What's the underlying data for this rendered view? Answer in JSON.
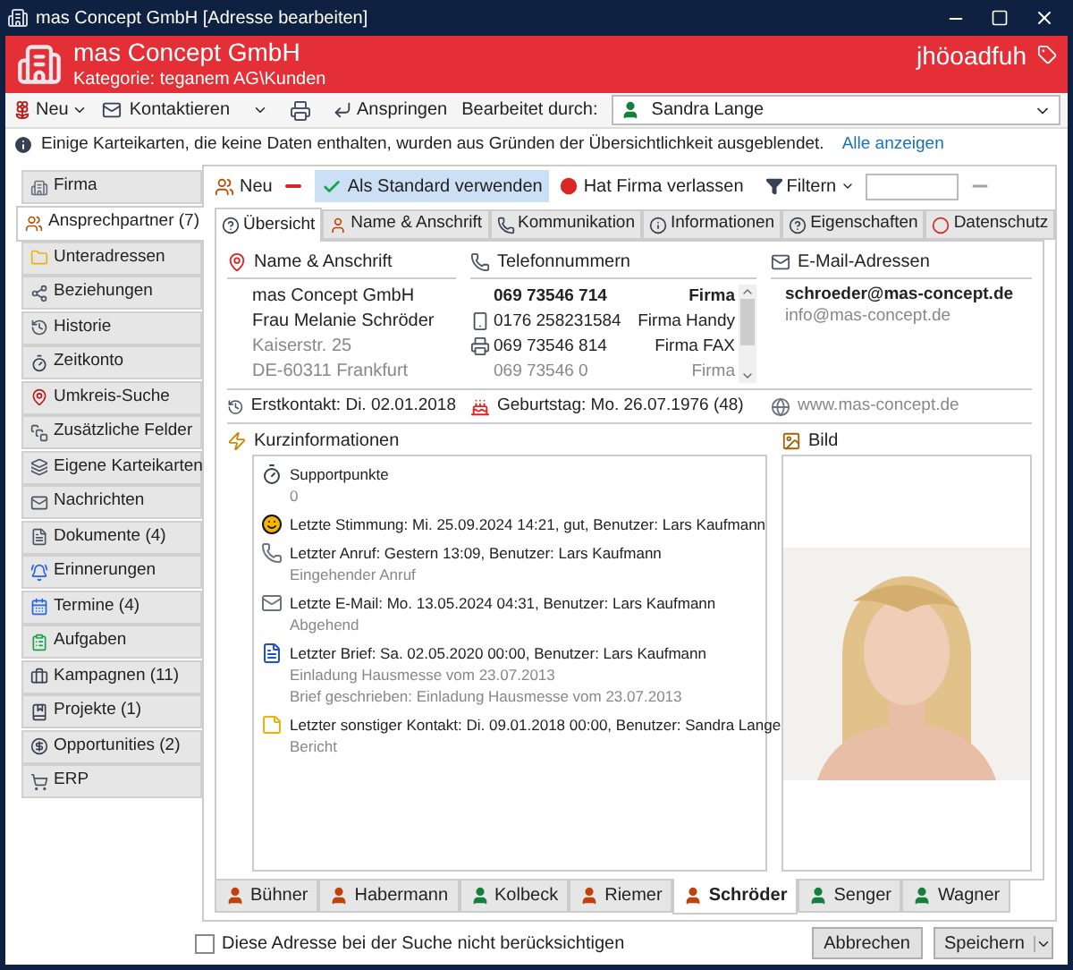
{
  "window": {
    "title": "mas Concept GmbH [Adresse bearbeiten]"
  },
  "header": {
    "company": "mas Concept GmbH",
    "category": "Kategorie: teganem AG\\Kunden",
    "code": "jhöoadfuh"
  },
  "toolbar": {
    "new": "Neu",
    "contact": "Kontaktieren",
    "jump": "Anspringen",
    "edited_by_label": "Bearbeitet durch:",
    "edited_by": "Sandra Lange"
  },
  "info_bar": {
    "message": "Einige Karteikarten, die keine Daten enthalten, wurden aus Gründen der Übersichtlichkeit ausgeblendet.",
    "link": "Alle anzeigen"
  },
  "sidebar": {
    "items": [
      {
        "label": "Firma",
        "selected": false
      },
      {
        "label": "Ansprechpartner (7)",
        "selected": true
      },
      {
        "label": "Unteradressen",
        "selected": false
      },
      {
        "label": "Beziehungen",
        "selected": false
      },
      {
        "label": "Historie",
        "selected": false
      },
      {
        "label": "Zeitkonto",
        "selected": false
      },
      {
        "label": "Umkreis-Suche",
        "selected": false
      },
      {
        "label": "Zusätzliche Felder",
        "selected": false
      },
      {
        "label": "Eigene Karteikarten",
        "selected": false
      },
      {
        "label": "Nachrichten",
        "selected": false
      },
      {
        "label": "Dokumente (4)",
        "selected": false
      },
      {
        "label": "Erinnerungen",
        "selected": false
      },
      {
        "label": "Termine (4)",
        "selected": false
      },
      {
        "label": "Aufgaben",
        "selected": false
      },
      {
        "label": "Kampagnen (11)",
        "selected": false
      },
      {
        "label": "Projekte (1)",
        "selected": false
      },
      {
        "label": "Opportunities (2)",
        "selected": false
      },
      {
        "label": "ERP",
        "selected": false
      }
    ]
  },
  "contact_toolbar": {
    "new": "Neu",
    "default": "Als Standard verwenden",
    "left": "Hat Firma verlassen",
    "filter": "Filtern"
  },
  "tabs": [
    {
      "label": "Übersicht",
      "selected": true
    },
    {
      "label": "Name & Anschrift",
      "selected": false
    },
    {
      "label": "Kommunikation",
      "selected": false
    },
    {
      "label": "Informationen",
      "selected": false
    },
    {
      "label": "Eigenschaften",
      "selected": false
    },
    {
      "label": "Datenschutz",
      "selected": false
    }
  ],
  "overview": {
    "address_heading": "Name & Anschrift",
    "address": {
      "company": "mas Concept GmbH",
      "name": "Frau Melanie Schröder",
      "street": "Kaiserstr. 25",
      "city": "DE-60311 Frankfurt"
    },
    "phones_heading": "Telefonnummern",
    "phones": [
      {
        "kind": "plain",
        "number": "069 73546 714",
        "type": "Firma",
        "primary": true,
        "muted": false
      },
      {
        "kind": "mobile",
        "number": "0176 258231584",
        "type": "Firma Handy",
        "primary": false,
        "muted": false
      },
      {
        "kind": "fax",
        "number": "069 73546 814",
        "type": "Firma FAX",
        "primary": false,
        "muted": false
      },
      {
        "kind": "plain",
        "number": "069 73546 0",
        "type": "Firma",
        "primary": false,
        "muted": true
      }
    ],
    "emails_heading": "E-Mail-Adressen",
    "emails": [
      {
        "address": "schroeder@mas-concept.de",
        "primary": true
      },
      {
        "address": "info@mas-concept.de",
        "primary": false
      }
    ],
    "first_contact": "Erstkontakt: Di. 02.01.2018",
    "birthday": "Geburtstag: Mo. 26.07.1976 (48)",
    "website": "www.mas-concept.de",
    "short_info_heading": "Kurzinformationen",
    "short_info": [
      {
        "kind": "support",
        "title": "Supportpunkte",
        "lines": [
          "0"
        ]
      },
      {
        "kind": "mood",
        "title": "Letzte Stimmung: Mi. 25.09.2024 14:21, gut, Benutzer: Lars Kaufmann"
      },
      {
        "kind": "call",
        "title": "Letzter Anruf: Gestern 13:09, Benutzer: Lars Kaufmann",
        "lines": [
          "Eingehender Anruf"
        ]
      },
      {
        "kind": "email",
        "title": "Letzte E-Mail: Mo. 13.05.2024 04:31, Benutzer: Lars Kaufmann",
        "lines": [
          "Abgehend"
        ]
      },
      {
        "kind": "letter",
        "title": "Letzter Brief: Sa. 02.05.2020 00:00, Benutzer: Lars Kaufmann",
        "lines": [
          "Einladung Hausmesse vom 23.07.2013",
          "Brief geschrieben: Einladung Hausmesse vom 23.07.2013"
        ]
      },
      {
        "kind": "other",
        "title": "Letzter sonstiger Kontakt: Di. 09.01.2018 00:00, Benutzer: Sandra Lange",
        "lines": [
          "Bericht"
        ]
      }
    ],
    "picture_heading": "Bild"
  },
  "person_tabs": [
    {
      "label": "Bühner",
      "kind": "female",
      "selected": false
    },
    {
      "label": "Habermann",
      "kind": "female",
      "selected": false
    },
    {
      "label": "Kolbeck",
      "kind": "male",
      "selected": false
    },
    {
      "label": "Riemer",
      "kind": "female",
      "selected": false
    },
    {
      "label": "Schröder",
      "kind": "female",
      "selected": true
    },
    {
      "label": "Senger",
      "kind": "male",
      "selected": false
    },
    {
      "label": "Wagner",
      "kind": "male",
      "selected": false
    }
  ],
  "exclude_from_search": {
    "label": "Diese Adresse bei der Suche nicht berücksichtigen",
    "checked": false
  },
  "buttons": [
    "Abbrechen",
    "Speichern"
  ]
}
